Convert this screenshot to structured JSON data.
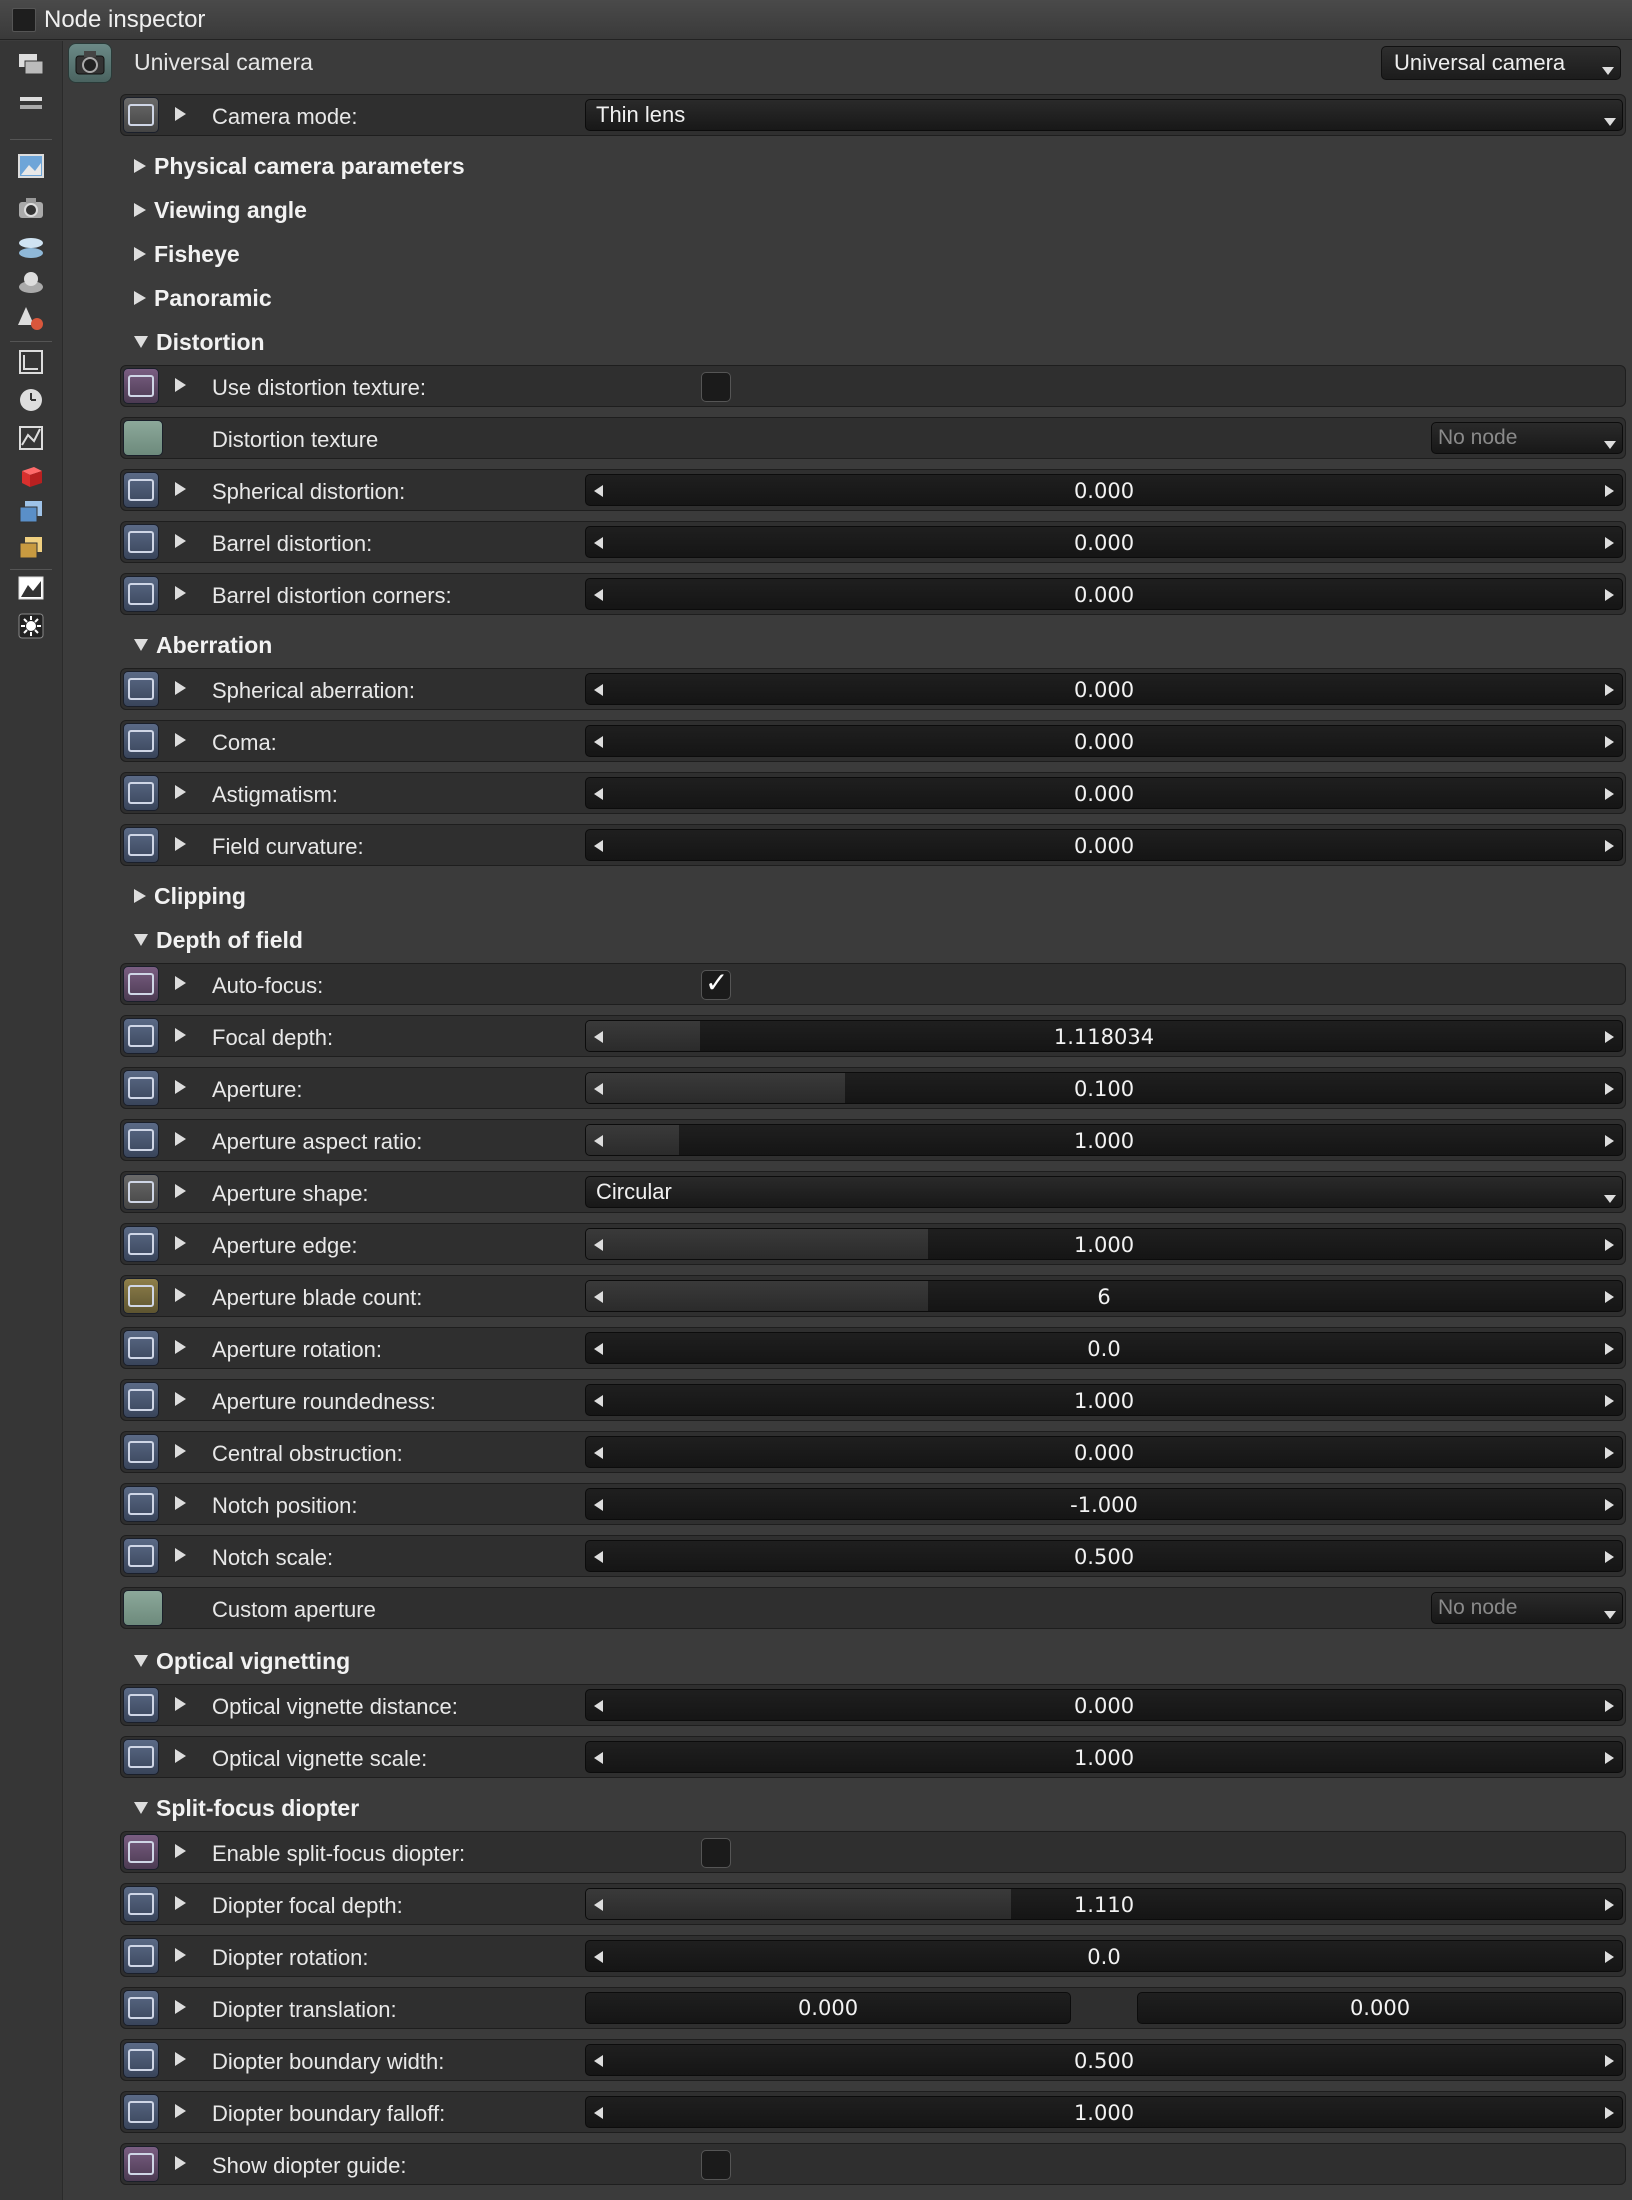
{
  "window": {
    "title": "Node inspector"
  },
  "header": {
    "node_title": "Universal camera",
    "node_type": "Universal camera"
  },
  "sidebar_icons": [
    "layers-icon",
    "list-icon",
    "image-icon",
    "camera-icon",
    "environment-icon",
    "geometry-icon",
    "material-icon",
    "render-target-icon",
    "clock-icon",
    "postprocess-icon",
    "red-cube-icon",
    "blue-cube-icon",
    "gold-cube-icon",
    "imager-icon",
    "light-icon"
  ],
  "rows": {
    "camera_mode": {
      "label": "Camera mode:",
      "value": "Thin lens"
    },
    "use_distortion_texture": {
      "label": "Use distortion texture:",
      "checked": false
    },
    "distortion_texture": {
      "label": "Distortion texture",
      "value": "No node"
    },
    "spherical_distortion": {
      "label": "Spherical distortion:",
      "value": "0.000",
      "fill": 0
    },
    "barrel_distortion": {
      "label": "Barrel distortion:",
      "value": "0.000",
      "fill": 0
    },
    "barrel_distortion_corners": {
      "label": "Barrel distortion corners:",
      "value": "0.000",
      "fill": 0
    },
    "spherical_aberration": {
      "label": "Spherical aberration:",
      "value": "0.000",
      "fill": 0
    },
    "coma": {
      "label": "Coma:",
      "value": "0.000",
      "fill": 0
    },
    "astigmatism": {
      "label": "Astigmatism:",
      "value": "0.000",
      "fill": 0
    },
    "field_curvature": {
      "label": "Field curvature:",
      "value": "0.000",
      "fill": 0
    },
    "auto_focus": {
      "label": "Auto-focus:",
      "checked": true
    },
    "focal_depth": {
      "label": "Focal depth:",
      "value": "1.118034",
      "fill": 0.11
    },
    "aperture": {
      "label": "Aperture:",
      "value": "0.100",
      "fill": 0.25
    },
    "aperture_aspect_ratio": {
      "label": "Aperture aspect ratio:",
      "value": "1.000",
      "fill": 0.09
    },
    "aperture_shape": {
      "label": "Aperture shape:",
      "value": "Circular"
    },
    "aperture_edge": {
      "label": "Aperture edge:",
      "value": "1.000",
      "fill": 0.33
    },
    "aperture_blade_count": {
      "label": "Aperture blade count:",
      "value": "6",
      "fill": 0.33
    },
    "aperture_rotation": {
      "label": "Aperture rotation:",
      "value": "0.0",
      "fill": 0
    },
    "aperture_roundedness": {
      "label": "Aperture roundedness:",
      "value": "1.000",
      "fill": 0
    },
    "central_obstruction": {
      "label": "Central obstruction:",
      "value": "0.000",
      "fill": 0
    },
    "notch_position": {
      "label": "Notch position:",
      "value": "-1.000",
      "fill": 0
    },
    "notch_scale": {
      "label": "Notch scale:",
      "value": "0.500",
      "fill": 0
    },
    "custom_aperture": {
      "label": "Custom aperture",
      "value": "No node"
    },
    "optical_vignette_distance": {
      "label": "Optical vignette distance:",
      "value": "0.000",
      "fill": 0
    },
    "optical_vignette_scale": {
      "label": "Optical vignette scale:",
      "value": "1.000",
      "fill": 0
    },
    "enable_split_focus_diopter": {
      "label": "Enable split-focus diopter:",
      "checked": false
    },
    "diopter_focal_depth": {
      "label": "Diopter focal depth:",
      "value": "1.110",
      "fill": 0.41
    },
    "diopter_rotation": {
      "label": "Diopter rotation:",
      "value": "0.0",
      "fill": 0
    },
    "diopter_translation": {
      "label": "Diopter translation:",
      "x": "0.000",
      "y": "0.000"
    },
    "diopter_boundary_width": {
      "label": "Diopter boundary width:",
      "value": "0.500",
      "fill": 0
    },
    "diopter_boundary_falloff": {
      "label": "Diopter boundary falloff:",
      "value": "1.000",
      "fill": 0
    },
    "show_diopter_guide": {
      "label": "Show diopter guide:",
      "checked": false
    }
  },
  "sections": {
    "physical_camera_parameters": {
      "label": "Physical camera parameters",
      "expanded": false
    },
    "viewing_angle": {
      "label": "Viewing angle",
      "expanded": false
    },
    "fisheye": {
      "label": "Fisheye",
      "expanded": false
    },
    "panoramic": {
      "label": "Panoramic",
      "expanded": false
    },
    "distortion": {
      "label": "Distortion",
      "expanded": true
    },
    "aberration": {
      "label": "Aberration",
      "expanded": true
    },
    "clipping": {
      "label": "Clipping",
      "expanded": false
    },
    "depth_of_field": {
      "label": "Depth of field",
      "expanded": true
    },
    "optical_vignetting": {
      "label": "Optical vignetting",
      "expanded": true
    },
    "split_focus_diopter": {
      "label": "Split-focus diopter",
      "expanded": true
    }
  }
}
